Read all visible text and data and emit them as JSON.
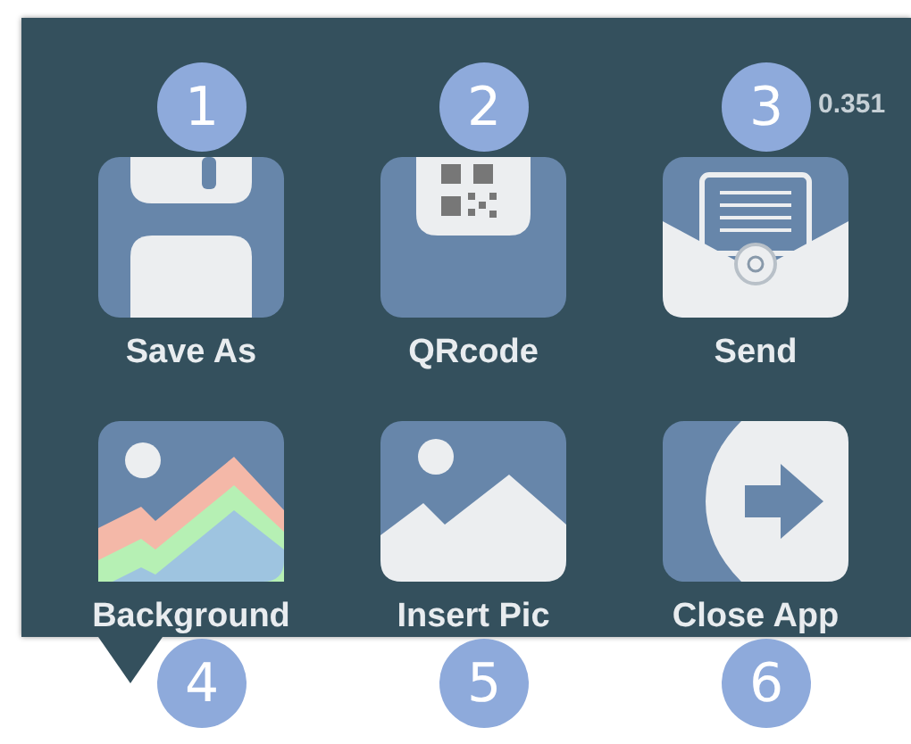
{
  "menu": {
    "corner_text": "0.351",
    "items": [
      {
        "label": "Save As",
        "kind": "floppy",
        "callout": "1"
      },
      {
        "label": "QRcode",
        "kind": "qrcode",
        "callout": "2"
      },
      {
        "label": "Send",
        "kind": "mail",
        "callout": "3"
      },
      {
        "label": "Background",
        "kind": "background",
        "callout": "4"
      },
      {
        "label": "Insert Pic",
        "kind": "image",
        "callout": "5"
      },
      {
        "label": "Close App",
        "kind": "exit",
        "callout": "6"
      }
    ]
  }
}
